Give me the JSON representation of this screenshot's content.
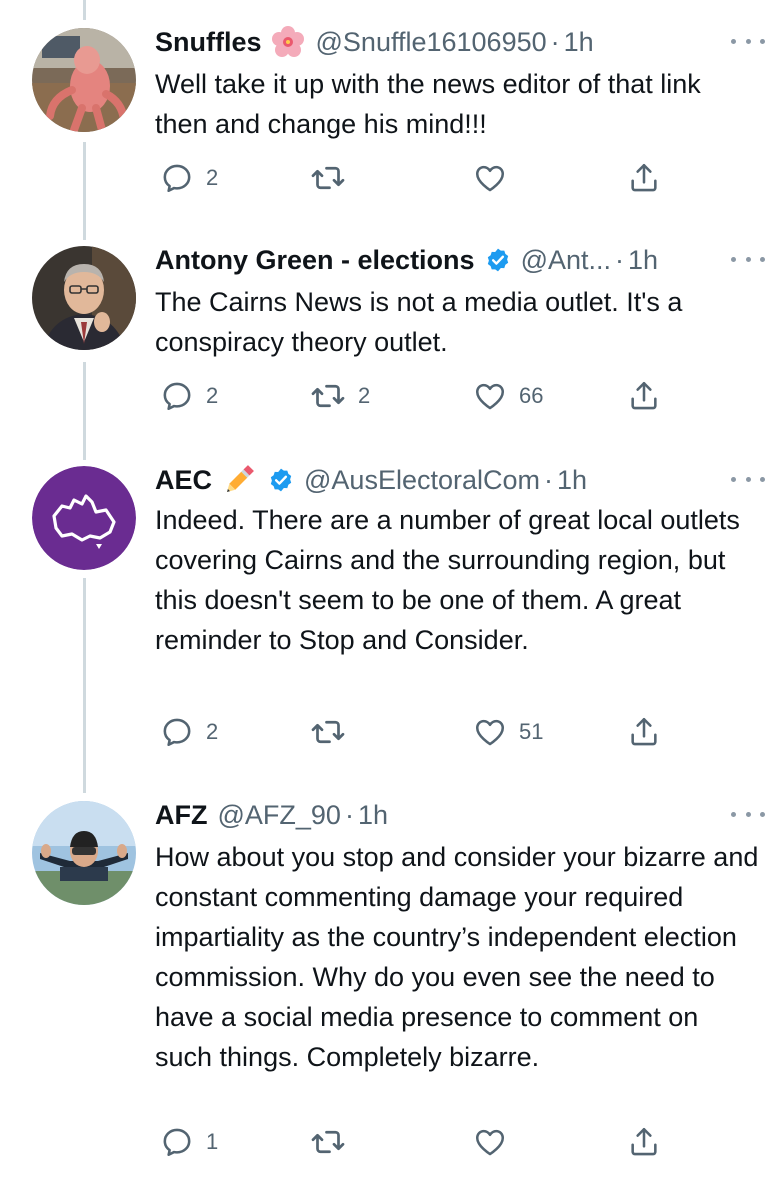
{
  "tweets": [
    {
      "name": "Snuffles",
      "emoji": "cherry-blossom-icon",
      "verified": false,
      "handle": "@Snuffle16106950",
      "dot": "·",
      "time": "1h",
      "text": "Well take it up with the news editor of that link then and change his mind!!!",
      "replies": "2",
      "retweets": "",
      "likes": "",
      "avatar": "pink-figure-avatar"
    },
    {
      "name": "Antony Green - elections",
      "emoji": "",
      "verified": true,
      "handle": "@Ant...",
      "dot": "·",
      "time": "1h",
      "text": "The Cairns News is not a media outlet. It's a conspiracy theory outlet.",
      "replies": "2",
      "retweets": "2",
      "likes": "66",
      "avatar": "man-with-glasses-avatar"
    },
    {
      "name": "AEC",
      "emoji": "pencil-icon",
      "verified": true,
      "handle": "@AusElectoralCom",
      "dot": "·",
      "time": "1h",
      "text": "Indeed. There are a number of great local outlets covering Cairns and the surrounding region, but this doesn't seem to be one of them. A great reminder to Stop and Consider.",
      "replies": "2",
      "retweets": "",
      "likes": "51",
      "avatar": "australia-logo-avatar"
    },
    {
      "name": "AFZ",
      "emoji": "",
      "verified": false,
      "handle": "@AFZ_90",
      "dot": "·",
      "time": "1h",
      "text": "How about you stop and consider your bizarre and constant commenting damage your required impartiality as the country’s independent election commission. Why do you even see the need to have a social media presence to comment on such things. Completely bizarre.",
      "replies": "1",
      "retweets": "",
      "likes": "",
      "avatar": "skydiver-avatar"
    }
  ],
  "colors": {
    "text": "#0f1419",
    "secondary": "#536471",
    "verified": "#1d9bf0",
    "aec_purple": "#6a2c91",
    "thread_line": "#cfd9de"
  }
}
